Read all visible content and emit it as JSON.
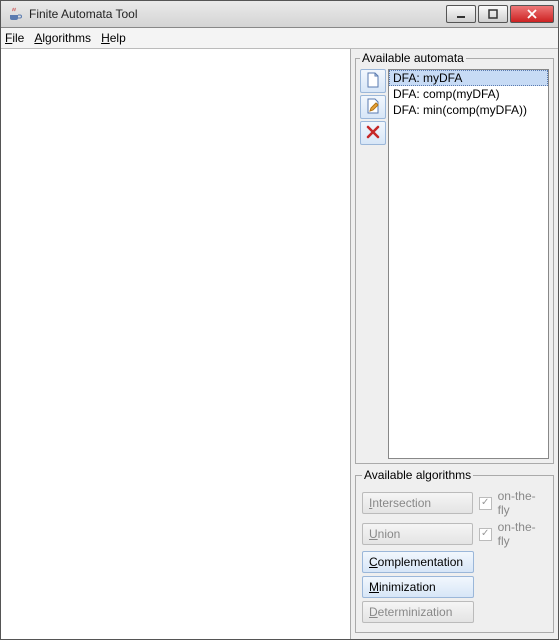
{
  "window": {
    "title": "Finite Automata Tool"
  },
  "menu": {
    "file": {
      "label": "File",
      "mnemonic": "F"
    },
    "algorithms": {
      "label": "Algorithms",
      "mnemonic": "A"
    },
    "help": {
      "label": "Help",
      "mnemonic": "H"
    }
  },
  "panels": {
    "available_automata": {
      "legend": "Available automata",
      "items": [
        {
          "label": "DFA: myDFA",
          "selected": true
        },
        {
          "label": "DFA: comp(myDFA)",
          "selected": false
        },
        {
          "label": "DFA: min(comp(myDFA))",
          "selected": false
        }
      ],
      "toolbar": {
        "new": "new-file",
        "edit": "edit-file",
        "delete": "delete"
      }
    },
    "available_algorithms": {
      "legend": "Available algorithms",
      "rows": {
        "intersection": {
          "label": "Intersection",
          "enabled": false,
          "checkbox_label": "on-the-fly",
          "checkbox_checked": true
        },
        "union": {
          "label": "Union",
          "enabled": false,
          "checkbox_label": "on-the-fly",
          "checkbox_checked": true
        },
        "complementation": {
          "label": "Complementation",
          "enabled": true
        },
        "minimization": {
          "label": "Minimization",
          "enabled": true
        },
        "determinization": {
          "label": "Determinization",
          "enabled": false
        }
      }
    }
  }
}
